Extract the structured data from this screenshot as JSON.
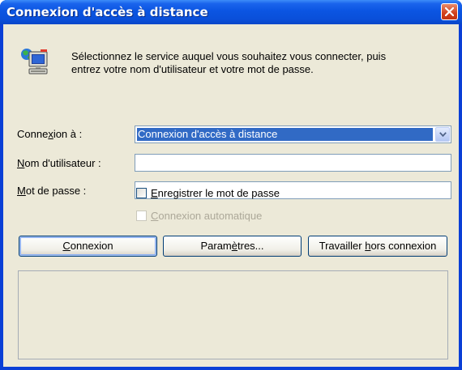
{
  "window": {
    "title": "Connexion d'accès à distance"
  },
  "info": {
    "line1": "Sélectionnez le service auquel vous souhaitez vous connecter, puis",
    "line2": "entrez votre nom d'utilisateur et votre mot de passe."
  },
  "form": {
    "connection": {
      "label_pre": "Conne",
      "label_key": "x",
      "label_post": "ion à :",
      "selected": "Connexion d'accès à distance"
    },
    "username": {
      "label_key": "N",
      "label_post": "om d'utilisateur :",
      "value": ""
    },
    "password": {
      "label_key": "M",
      "label_post": "ot de passe :",
      "value": ""
    },
    "save_password": {
      "label_key": "E",
      "label_post": "nregistrer le mot de passe",
      "checked": false
    },
    "auto_connect": {
      "label_key": "C",
      "label_post": "onnexion automatique",
      "checked": false,
      "enabled": false
    }
  },
  "buttons": {
    "connect": {
      "pre": "",
      "key": "C",
      "post": "onnexion"
    },
    "settings": {
      "pre": "Param",
      "key": "è",
      "post": "tres..."
    },
    "offline": {
      "pre": "Travailler ",
      "key": "h",
      "post": "ors connexion"
    }
  },
  "icons": {
    "close": "close-icon",
    "connection": "dialup-computer-icon",
    "combo_arrow": "chevron-down-icon"
  },
  "colors": {
    "titlebar": "#0a4fd9",
    "client_bg": "#ece9d8",
    "selection": "#316ac5",
    "close_button": "#d2401b"
  }
}
